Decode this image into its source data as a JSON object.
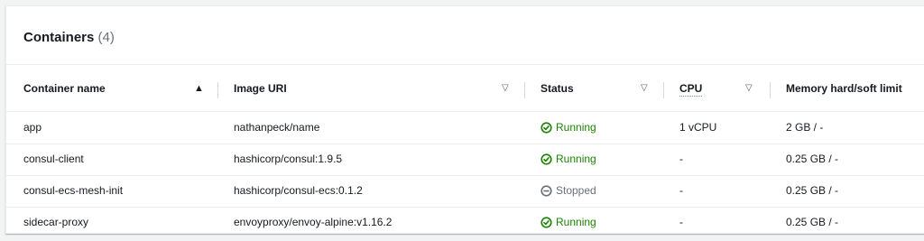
{
  "panel": {
    "title": "Containers",
    "count": "(4)"
  },
  "table": {
    "columns": [
      {
        "label": "Container name",
        "sort": "asc"
      },
      {
        "label": "Image URI"
      },
      {
        "label": "Status"
      },
      {
        "label": "CPU"
      },
      {
        "label": "Memory hard/soft limit"
      }
    ],
    "rows": [
      {
        "name": "app",
        "image": "nathanpeck/name",
        "status": "Running",
        "cpu": "1 vCPU",
        "memory": "2 GB / -"
      },
      {
        "name": "consul-client",
        "image": "hashicorp/consul:1.9.5",
        "status": "Running",
        "cpu": "-",
        "memory": "0.25 GB / -"
      },
      {
        "name": "consul-ecs-mesh-init",
        "image": "hashicorp/consul-ecs:0.1.2",
        "status": "Stopped",
        "cpu": "-",
        "memory": "0.25 GB / -"
      },
      {
        "name": "sidecar-proxy",
        "image": "envoyproxy/envoy-alpine:v1.16.2",
        "status": "Running",
        "cpu": "-",
        "memory": "0.25 GB / -"
      }
    ]
  },
  "colors": {
    "running": "#1d8102",
    "stopped": "#687078"
  },
  "icons": {
    "running": "check-circle-icon",
    "stopped": "minus-circle-icon"
  }
}
